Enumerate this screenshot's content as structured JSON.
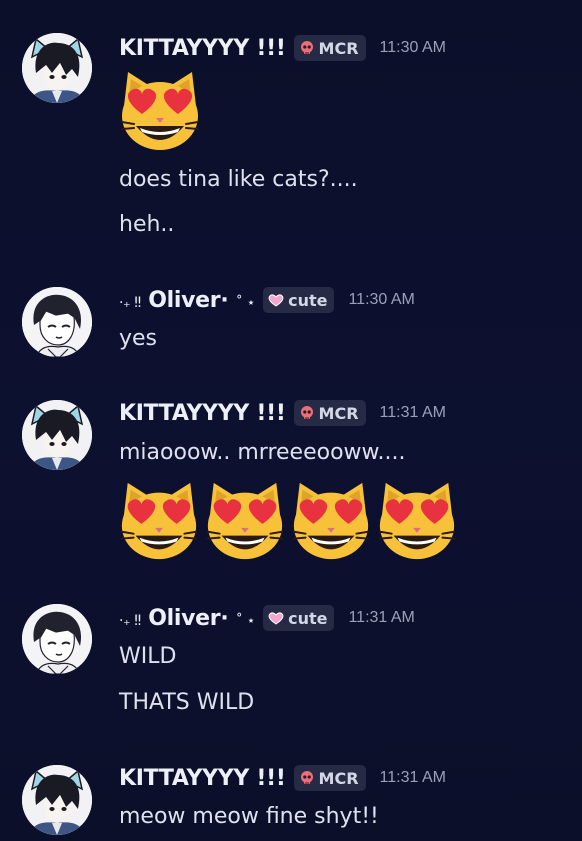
{
  "messages": [
    {
      "author": "KITTAYYYY !!!",
      "role_tag": "MCR",
      "role_icon": "skull-icon",
      "time": "11:30 AM",
      "emoji_count": 1,
      "lines": [
        "does tina like cats?....",
        "heh.."
      ]
    },
    {
      "author_prefix": "·₊ ‼",
      "author": "Oliver·",
      "author_suffix": "˚ ⋆",
      "role_tag": "cute",
      "role_icon": "pink-heart-icon",
      "time": "11:30 AM",
      "lines": [
        "yes"
      ]
    },
    {
      "author": "KITTAYYYY !!!",
      "role_tag": "MCR",
      "role_icon": "skull-icon",
      "time": "11:31 AM",
      "lines": [
        "miaooow.. mrreeeooww...."
      ],
      "emoji_count": 4
    },
    {
      "author_prefix": "·₊ ‼",
      "author": "Oliver·",
      "author_suffix": "˚ ⋆",
      "role_tag": "cute",
      "role_icon": "pink-heart-icon",
      "time": "11:31 AM",
      "lines": [
        "WILD",
        "THATS WILD"
      ]
    },
    {
      "author": "KITTAYYYY !!!",
      "role_tag": "MCR",
      "role_icon": "skull-icon",
      "time": "11:31 AM",
      "lines": [
        "meow meow fine shyt!!"
      ]
    }
  ],
  "colors": {
    "background": "#0b0f2a",
    "tag_background": "#262a44",
    "timestamp": "#9aa0b8",
    "emoji_face": "#f7c23a",
    "heart": "#e8323f"
  }
}
